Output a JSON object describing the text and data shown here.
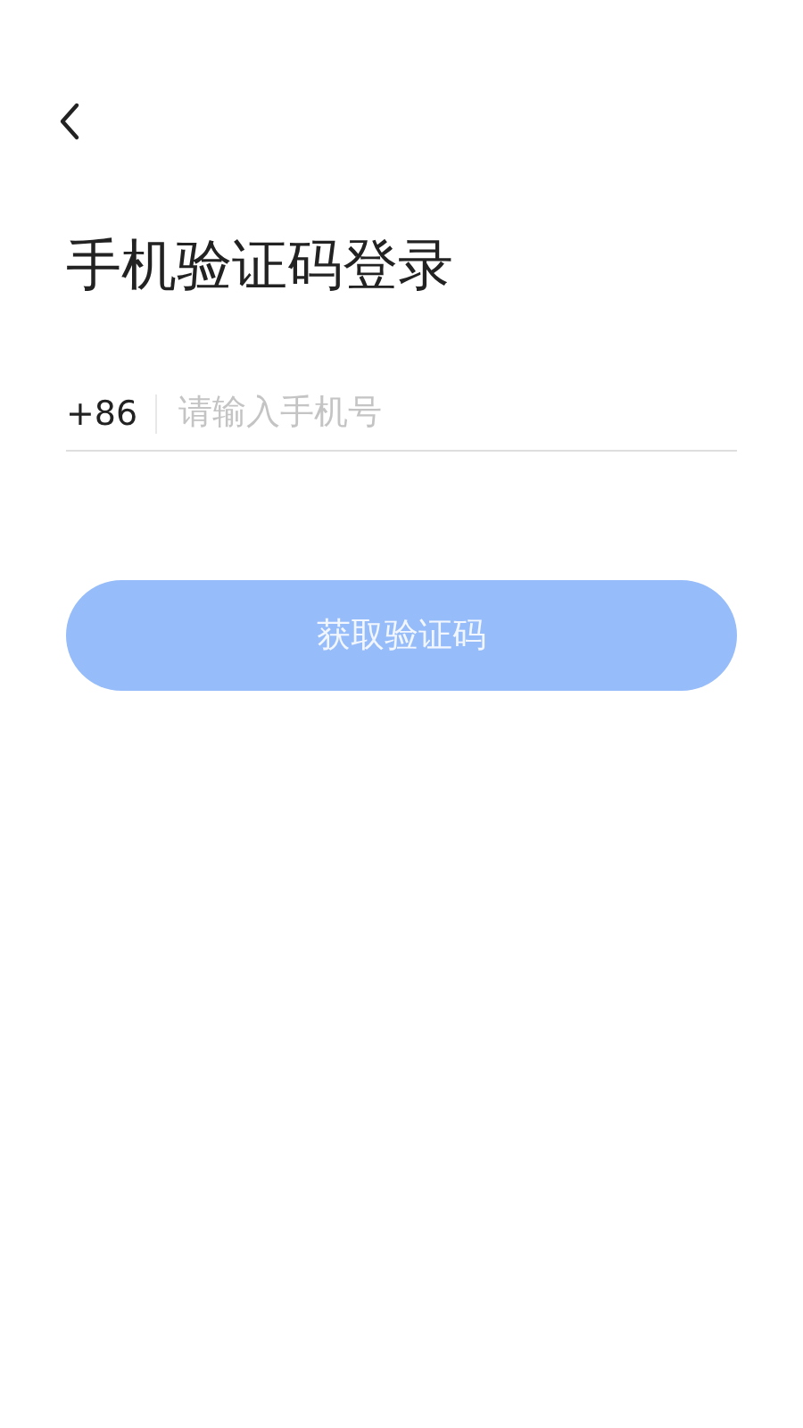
{
  "title": "手机验证码登录",
  "phone_field": {
    "country_code": "+86",
    "placeholder": "请输入手机号"
  },
  "submit_button": {
    "label": "获取验证码",
    "disabled": true
  }
}
